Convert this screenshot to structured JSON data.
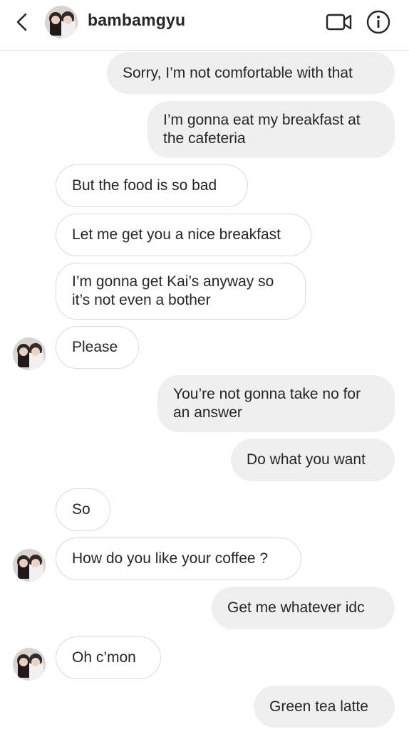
{
  "header": {
    "back_icon": "chevron-left-icon",
    "avatar_icon": "profile-photo",
    "username": "bambamgyu",
    "video_icon": "video-camera-icon",
    "info_icon": "info-icon"
  },
  "messages": [
    {
      "side": "out",
      "text": "Sorry, I’m not comfortable with that"
    },
    {
      "side": "out",
      "text": "I’m gonna eat my breakfast at the cafeteria"
    },
    {
      "side": "in",
      "text": "But the food is so bad"
    },
    {
      "side": "in",
      "text": "Let me get you a nice breakfast"
    },
    {
      "side": "in",
      "text": "I’m gonna get Kai’s anyway so it’s not even a bother"
    },
    {
      "side": "in",
      "text": "Please",
      "avatar": true
    },
    {
      "side": "out",
      "text": "You’re not gonna take no for an answer"
    },
    {
      "side": "out",
      "text": "Do what you want"
    },
    {
      "side": "in",
      "text": "So"
    },
    {
      "side": "in",
      "text": "How do you like your coffee ?",
      "avatar": true
    },
    {
      "side": "out",
      "text": "Get me whatever idc"
    },
    {
      "side": "in",
      "text": "Oh c’mon",
      "avatar": true
    },
    {
      "side": "out",
      "text": "Green tea latte"
    }
  ],
  "colors": {
    "outgoing_bubble": "#efefef",
    "incoming_border": "#dbdbdb",
    "text": "#262626"
  }
}
